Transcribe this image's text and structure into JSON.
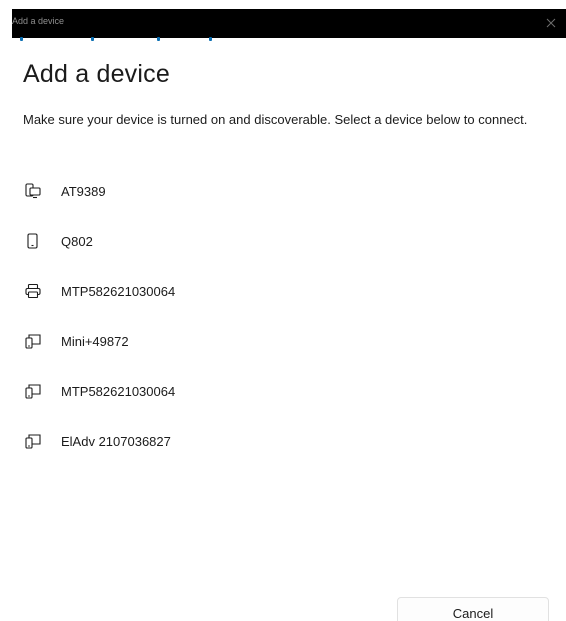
{
  "window": {
    "title": "Add a device"
  },
  "heading": "Add a device",
  "instructions": "Make sure your device is turned on and discoverable. Select a device below to connect.",
  "devices": [
    {
      "name": "AT9389",
      "icon": "phone-computer-icon"
    },
    {
      "name": "Q802",
      "icon": "phone-icon"
    },
    {
      "name": "MTP582621030064",
      "icon": "printer-icon"
    },
    {
      "name": "Mini+49872",
      "icon": "device-generic-icon"
    },
    {
      "name": "MTP582621030064",
      "icon": "device-generic-icon"
    },
    {
      "name": "ElAdv 2107036827",
      "icon": "device-generic-icon"
    }
  ],
  "buttons": {
    "cancel": "Cancel"
  },
  "colors": {
    "titlebar_bg": "#000000",
    "accent": "#0b6fb3",
    "text": "#1b1b1b"
  }
}
